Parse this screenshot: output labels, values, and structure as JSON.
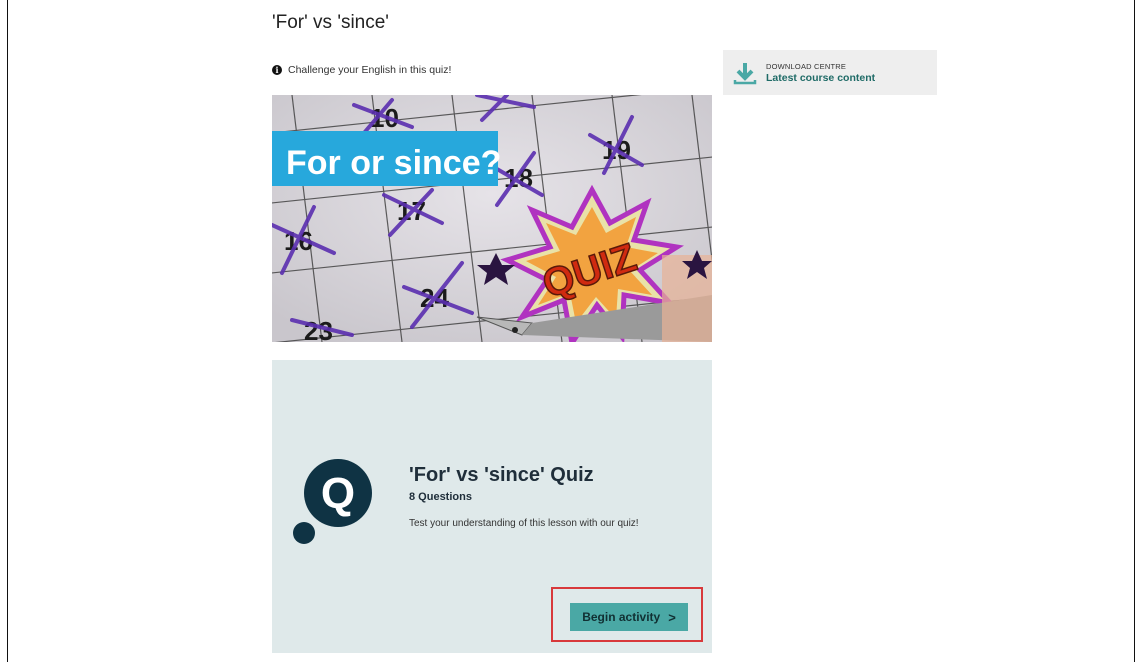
{
  "page": {
    "title": "'For' vs 'since'",
    "intro": "Challenge your English in this quiz!"
  },
  "hero": {
    "banner_text": "For or since?",
    "quiz_badge": "QUIZ",
    "calendar_numbers": [
      "10",
      "19",
      "17",
      "18",
      "16",
      "24",
      "23"
    ]
  },
  "quiz": {
    "title": "'For' vs 'since' Quiz",
    "question_count": "8 Questions",
    "description": "Test your understanding of this lesson with our quiz!",
    "begin_label": "Begin activity",
    "begin_chevron": ">",
    "logo_letter": "Q"
  },
  "download_centre": {
    "label": "DOWNLOAD CENTRE",
    "link": "Latest course content"
  },
  "icons": {
    "info": "info-icon",
    "download": "download-icon",
    "quiz_logo": "q-logo-icon"
  },
  "colors": {
    "accent": "#4aa8a5",
    "quiz_panel_bg": "#dfe9ea",
    "highlight": "#d8393b",
    "banner_bg": "#27a8dc",
    "calendar_marks": "#5b2fb0"
  }
}
